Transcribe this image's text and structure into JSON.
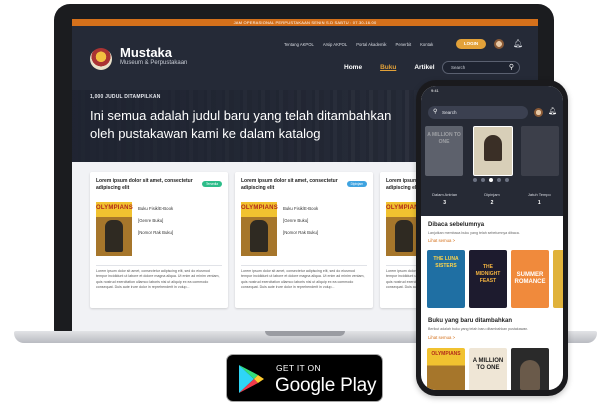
{
  "website": {
    "top_banner": "JAM OPERASIONAL PERPUSTAKAAN SENIN S.D SABTU : 07.30-16.00",
    "brand": {
      "name": "Mustaka",
      "subtitle": "Museum & Perpustakaan"
    },
    "util_links": [
      "Tentang AKPOL",
      "Arsip AKPOL",
      "Portal Akademik",
      "Penerbit",
      "Kontak"
    ],
    "login_label": "LOGIN",
    "nav": [
      "Home",
      "Buku",
      "Artikel"
    ],
    "nav_active": "Buku",
    "search_placeholder": "Search",
    "hero": {
      "count": "1,000 JUDUL DITAMPILKAN",
      "title": "Ini semua adalah judul baru yang telah ditambahkan oleh pustakawan kami ke dalam katalog"
    },
    "cards": [
      {
        "title": "Lorem ipsum dolor sit amet, consectetur adipiscing elit",
        "badge": "Tersedia",
        "badge_color": "#2dbd8a",
        "cover_text": "OLYMPIANS",
        "meta": [
          "Buku Fisik/E-Book",
          "[Genre Buku]",
          "[Nomor Rak Buku]"
        ],
        "desc": "Lorem ipsum dolor sit amet, consectetur adipiscing elit, sed do eiusmod tempor incididunt ut labore et dolore magna aliqua. Ut enim ad minim veniam, quis nostrud exercitation ullamco laboris nisi ut aliquip ex ea commodo consequat. Duis aute irure dolor in reprehenderit in volup..."
      },
      {
        "title": "Lorem ipsum dolor sit amet, consectetur adipiscing elit",
        "badge": "Dipinjam",
        "badge_color": "#3fa3e0",
        "cover_text": "OLYMPIANS",
        "meta": [
          "Buku Fisik/E-Book",
          "[Genre Buku]",
          "[Nomor Rak Buku]"
        ],
        "desc": "Lorem ipsum dolor sit amet, consectetur adipiscing elit, sed do eiusmod tempor incididunt ut labore et dolore magna aliqua. Ut enim ad minim veniam, quis nostrud exercitation ullamco laboris nisi ut aliquip ex ea commodo consequat. Duis aute irure dolor in reprehenderit in volup..."
      },
      {
        "title": "Lorem ipsum dolor sit amet, consectetur adipiscing elit",
        "badge": "",
        "badge_color": "#2dbd8a",
        "cover_text": "OLYMPIANS",
        "meta": [
          "Buku Fisik/E-Book",
          "[Genre Buku]",
          "[Nomor Rak Buku]"
        ],
        "desc": "Lorem ipsum dolor sit amet, consectetur adipiscing elit, sed do eiusmod tempor incididunt ut labore et dolore magna aliqua. Ut enim ad minim veniam, quis nostrud exercitation ullamco laboris nisi ut aliquip ex ea commodo consequat. Duis aute irure dolor in reprehenderit in volup..."
      }
    ]
  },
  "phone": {
    "status_time": "9:41",
    "search_placeholder": "Search",
    "stats": [
      {
        "label": "Dalam Antrian",
        "value": "3"
      },
      {
        "label": "Dipinjam",
        "value": "2"
      },
      {
        "label": "Jatuh Tempo",
        "value": "1"
      }
    ],
    "recent": {
      "title": "Dibaca sebelumnya",
      "subtitle": "Lanjutkan membaca buku yang telah sebelumnya dibaca.",
      "link": "Lihat semua >",
      "covers": [
        "THE LUNA SISTERS",
        "THE MIDNIGHT FEAST",
        "SUMMER ROMANCE"
      ]
    },
    "new_books": {
      "title": "Buku yang baru ditambahkan",
      "subtitle": "Berikut adalah buku yang telah baru ditambahkan pustakawan.",
      "link": "Lihat semua >",
      "covers": [
        "OLYMPIANS",
        "A MILLION TO ONE",
        ""
      ]
    },
    "carousel_covers": [
      "A MILLION TO ONE",
      "",
      ""
    ]
  },
  "store_badge": {
    "small": "GET IT ON",
    "big": "Google Play"
  }
}
